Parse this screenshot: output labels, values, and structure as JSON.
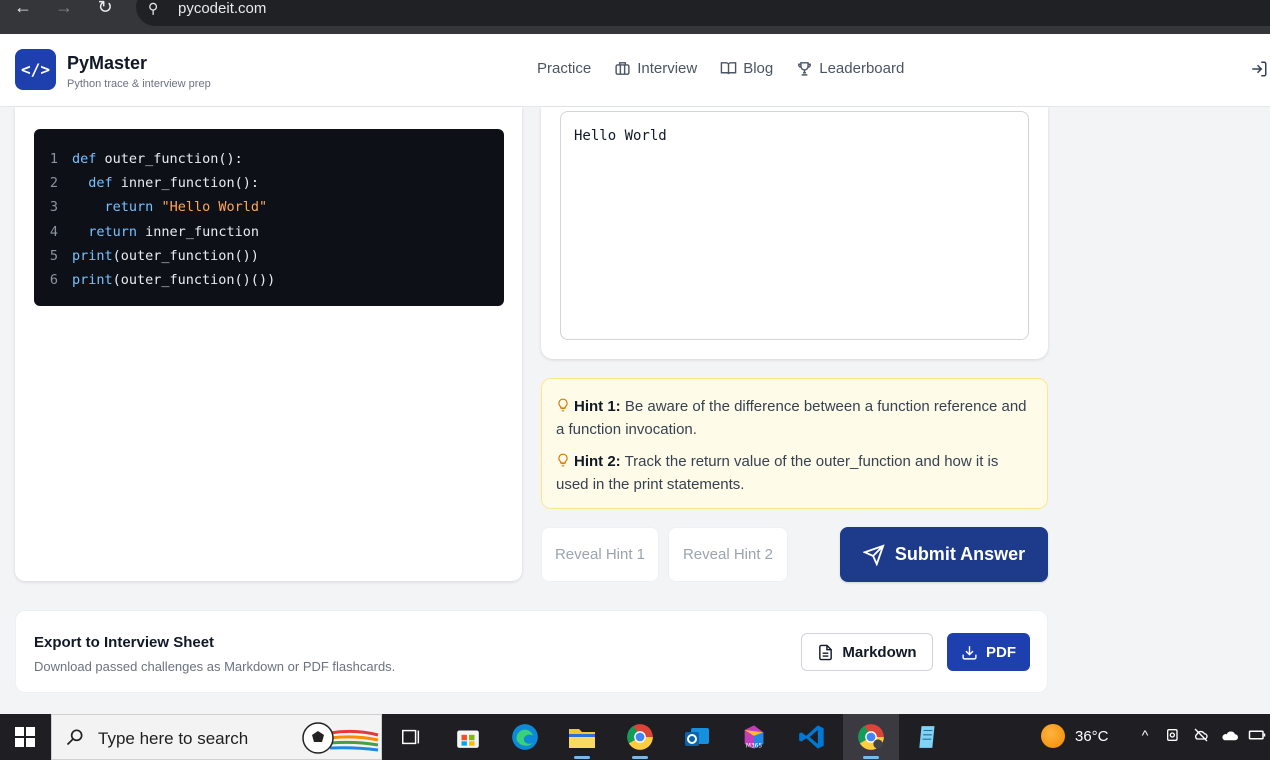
{
  "browser": {
    "url": "pycodeit.com",
    "back_icon": "arrow-left-icon",
    "forward_icon": "arrow-right-icon",
    "reload_icon": "reload-icon"
  },
  "header": {
    "logo_text": "</>",
    "brand": "PyMaster",
    "tagline": "Python trace & interview prep",
    "nav": [
      {
        "label": "Practice",
        "icon": ""
      },
      {
        "label": "Interview",
        "icon": "briefcase-icon"
      },
      {
        "label": "Blog",
        "icon": "book-icon"
      },
      {
        "label": "Leaderboard",
        "icon": "trophy-icon"
      }
    ],
    "logout_icon": "log-in-icon"
  },
  "code": {
    "lines": [
      {
        "no": "1",
        "text": "def outer_function():"
      },
      {
        "no": "2",
        "text": "  def inner_function():"
      },
      {
        "no": "3",
        "text": "    return \"Hello World\""
      },
      {
        "no": "4",
        "text": "  return inner_function"
      },
      {
        "no": "5",
        "text": "print(outer_function())"
      },
      {
        "no": "6",
        "text": "print(outer_function()())"
      }
    ]
  },
  "answer": {
    "value": "Hello World"
  },
  "hints": [
    {
      "title": "Hint 1:",
      "text": " Be aware of the difference between a function reference and a function invocation."
    },
    {
      "title": "Hint 2:",
      "text": " Track the return value of the outer_function and how it is used in the print statements."
    }
  ],
  "actions": {
    "reveal_hint_1": "Reveal Hint 1",
    "reveal_hint_2": "Reveal Hint 2",
    "submit": "Submit Answer"
  },
  "export": {
    "title": "Export to Interview Sheet",
    "subtitle": "Download passed challenges as Markdown or PDF flashcards.",
    "markdown_label": "Markdown",
    "pdf_label": "PDF"
  },
  "taskbar": {
    "search_placeholder": "Type here to search",
    "temperature": "36°C"
  },
  "colors": {
    "primary": "#1e40af",
    "submit": "#1e3a8a",
    "hint_bg": "#fefce8",
    "code_bg": "#0d1117"
  }
}
